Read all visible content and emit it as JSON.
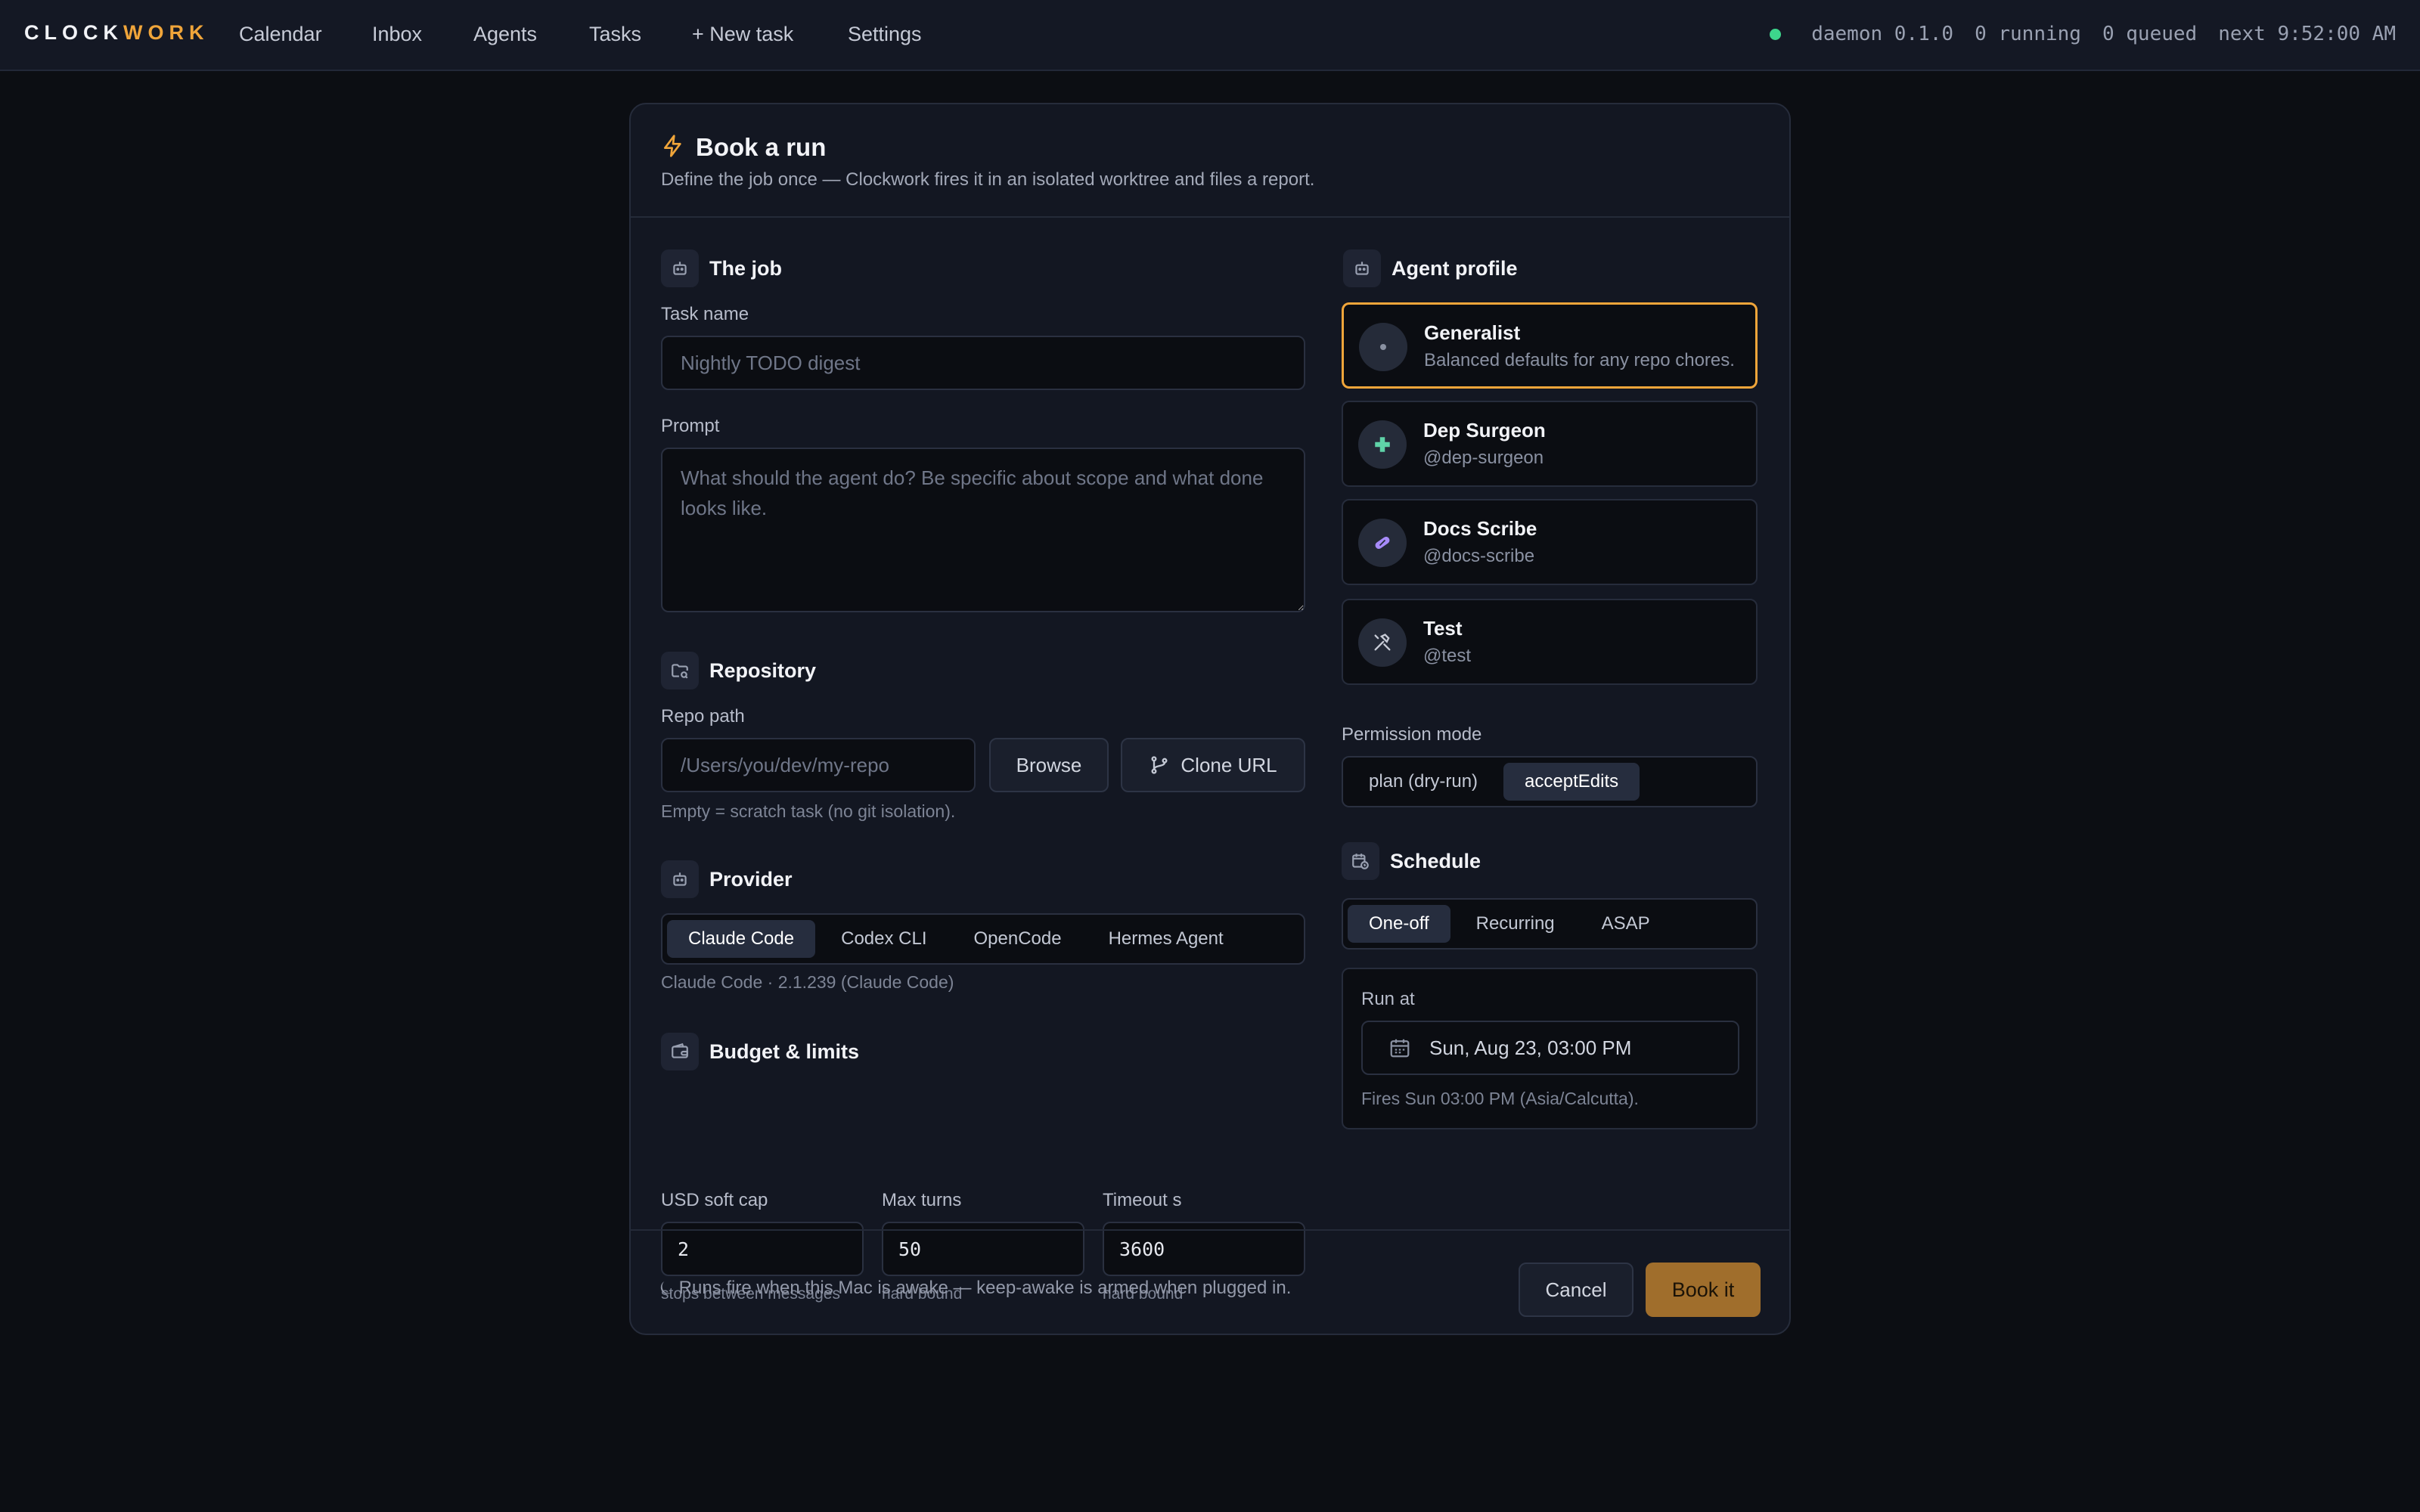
{
  "app": {
    "logo_prefix": "CLOCK",
    "logo_accent": "WORK",
    "accent_color": "#f0a53a"
  },
  "nav": {
    "items": [
      "Calendar",
      "Inbox",
      "Agents",
      "Tasks",
      "+ New task",
      "Settings"
    ]
  },
  "status": {
    "daemon": "daemon 0.1.0",
    "running": "0 running",
    "queued": "0 queued",
    "next": "next 9:52:00 AM",
    "dot_color": "#3dd68c"
  },
  "dialog": {
    "title": "Book a run",
    "subtitle": "Define the job once — Clockwork fires it in an isolated worktree and files a report."
  },
  "job": {
    "section_title": "The job",
    "task_name_label": "Task name",
    "task_name_value": "",
    "task_name_placeholder": "Nightly TODO digest",
    "prompt_label": "Prompt",
    "prompt_value": "",
    "prompt_placeholder": "What should the agent do? Be specific about scope and what done looks like."
  },
  "repository": {
    "section_title": "Repository",
    "repo_path_label": "Repo path",
    "repo_path_value": "",
    "repo_path_placeholder": "/Users/you/dev/my-repo",
    "browse_label": "Browse",
    "clone_label": "Clone URL",
    "hint": "Empty = scratch task (no git isolation)."
  },
  "provider": {
    "section_title": "Provider",
    "options": [
      "Claude Code",
      "Codex CLI",
      "OpenCode",
      "Hermes Agent"
    ],
    "selected": "Claude Code",
    "version_hint": "Claude Code · 2.1.239 (Claude Code)"
  },
  "budget": {
    "section_title": "Budget & limits",
    "usd_label": "USD soft cap",
    "usd_value": "2",
    "usd_hint": "stops between messages",
    "turns_label": "Max turns",
    "turns_value": "50",
    "turns_hint": "hard bound",
    "timeout_label": "Timeout s",
    "timeout_value": "3600",
    "timeout_hint": "hard bound"
  },
  "agent_profile": {
    "section_title": "Agent profile",
    "profiles": [
      {
        "name": "Generalist",
        "handle": "Balanced defaults for any repo chores.",
        "icon": "dot-icon",
        "selected": true
      },
      {
        "name": "Dep Surgeon",
        "handle": "@dep-surgeon",
        "icon": "plus-icon",
        "icon_color": "#5fd3a8",
        "selected": false
      },
      {
        "name": "Docs Scribe",
        "handle": "@docs-scribe",
        "icon": "pill-icon",
        "icon_color": "#a78bfa",
        "selected": false
      },
      {
        "name": "Test",
        "handle": "@test",
        "icon": "hammer-wrench-icon",
        "icon_color": "#c7cbd6",
        "selected": false
      }
    ]
  },
  "permission": {
    "label": "Permission mode",
    "options": [
      "plan (dry-run)",
      "acceptEdits"
    ],
    "selected": "acceptEdits"
  },
  "schedule": {
    "section_title": "Schedule",
    "options": [
      "One-off",
      "Recurring",
      "ASAP"
    ],
    "selected": "One-off",
    "run_at_label": "Run at",
    "run_at_value": "Sun, Aug 23, 03:00 PM",
    "fires_hint": "Fires Sun 03:00 PM (Asia/Calcutta)."
  },
  "footer": {
    "note": "⏾ Runs fire when this Mac is awake — keep-awake is armed when plugged in.",
    "cancel_label": "Cancel",
    "book_label": "Book it"
  }
}
